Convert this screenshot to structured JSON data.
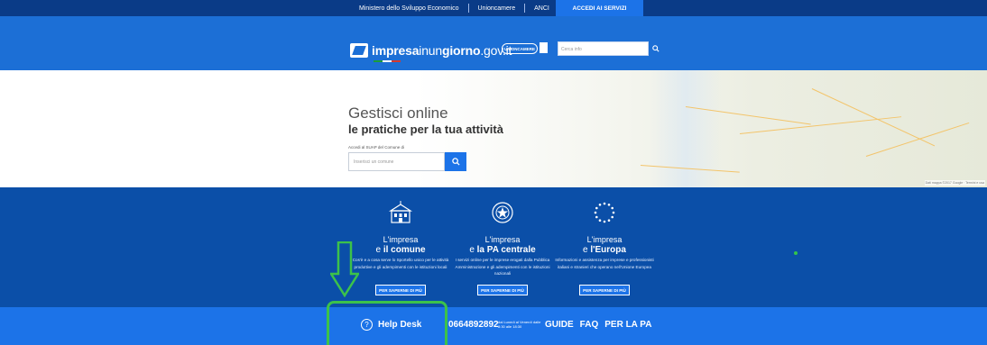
{
  "topbar": {
    "links": [
      "Ministero dello Sviluppo Economico",
      "Unioncamere",
      "ANCI"
    ],
    "accedi": "ACCEDI AI SERVIZI"
  },
  "header": {
    "logo_bold": "impresa",
    "logo_mid": "inun",
    "logo_bold2": "giorno",
    "logo_tld": ".gov.it",
    "unioncamere_badge": "UNIONCAMERE",
    "search_placeholder": "Cerca info"
  },
  "hero": {
    "title": "Gestisci online",
    "subtitle": "le pratiche per la tua attività",
    "suap_label": "Accedi al SUAP del Comune di",
    "comune_placeholder": "Inserisci un comune",
    "map_credit": "Dati mappa ©2017 Google · Termini e usa"
  },
  "services": [
    {
      "icon": "town-hall-icon",
      "line1": "L'impresa",
      "line2_pre": "e ",
      "line2_bold": "il comune",
      "desc": "Cos'è e a cosa serve lo Sportello unico per le attività produttive e gli adempimenti con le istituzioni locali",
      "button": "PER SAPERNE DI PIÙ"
    },
    {
      "icon": "italian-emblem-icon",
      "line1": "L'impresa",
      "line2_pre": "e ",
      "line2_bold": "la PA centrale",
      "desc": "I servizi online per le imprese erogati dalla Pubblica Amministrazione e gli adempimenti con le istituzioni nazionali",
      "button": "PER SAPERNE DI PIÙ"
    },
    {
      "icon": "eu-stars-icon",
      "line1": "L'impresa",
      "line2_pre": "e ",
      "line2_bold": "l'Europa",
      "desc": "Informazioni e assistenza per imprese e professionisti italiani e stranieri che operano nell'Unione Europea",
      "button": "PER SAPERNE DI PIÙ"
    }
  ],
  "footer": {
    "help_label": "Help Desk",
    "phone": "0664892892",
    "hours": "dal Lunedì al Venerdì dalle 8:30 alle 18:30",
    "links": [
      "GUIDE",
      "FAQ",
      "PER LA PA"
    ]
  },
  "colors": {
    "topbar": "#0a3b87",
    "header": "#1c6fd6",
    "services_bg": "#0b4fa8",
    "footer": "#1c73e8",
    "annotation": "#3cc24a"
  }
}
